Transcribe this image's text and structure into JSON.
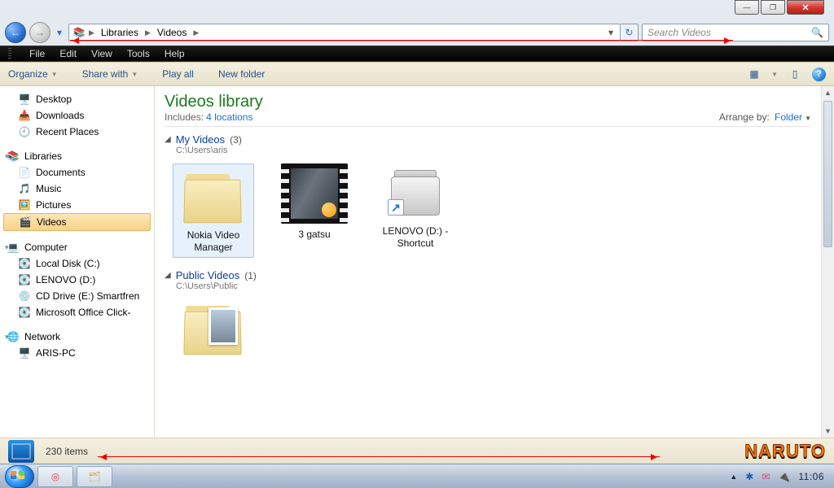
{
  "window_controls": {
    "min": "—",
    "max": "❐",
    "close": "✕"
  },
  "address": {
    "back_icon": "←",
    "fwd_icon": "→",
    "history_icon": "▾",
    "crumbs": [
      "Libraries",
      "Videos"
    ],
    "dropdown_icon": "▾",
    "refresh_icon": "↻"
  },
  "search": {
    "placeholder": "Search Videos",
    "icon": "🔍"
  },
  "menu": {
    "items": [
      "File",
      "Edit",
      "View",
      "Tools",
      "Help"
    ]
  },
  "toolbar": {
    "organize": "Organize",
    "share": "Share with",
    "playall": "Play all",
    "newfolder": "New folder",
    "dd": "▼",
    "view_icon": "▦",
    "pane_icon": "▯",
    "help": "?"
  },
  "nav": {
    "favorites": [
      {
        "icon": "🖥️",
        "label": "Desktop"
      },
      {
        "icon": "📥",
        "label": "Downloads"
      },
      {
        "icon": "🕘",
        "label": "Recent Places"
      }
    ],
    "libraries_label": "Libraries",
    "libraries_icon": "📚",
    "libraries": [
      {
        "icon": "📄",
        "label": "Documents"
      },
      {
        "icon": "🎵",
        "label": "Music"
      },
      {
        "icon": "🖼️",
        "label": "Pictures"
      },
      {
        "icon": "🎬",
        "label": "Videos",
        "selected": true
      }
    ],
    "computer_label": "Computer",
    "computer_icon": "💻",
    "drives": [
      {
        "icon": "💽",
        "label": "Local Disk (C:)"
      },
      {
        "icon": "💽",
        "label": "LENOVO (D:)"
      },
      {
        "icon": "💿",
        "label": "CD Drive (E:) Smartfren"
      },
      {
        "icon": "💽",
        "label": "Microsoft Office Click-"
      }
    ],
    "network_label": "Network",
    "network_icon": "🌐",
    "network": [
      {
        "icon": "🖥️",
        "label": "ARIS-PC"
      }
    ],
    "tri_open": "▾",
    "tri_closed": "▸"
  },
  "content": {
    "title": "Videos library",
    "includes_label": "Includes:",
    "includes_link": "4 locations",
    "arrange_label": "Arrange by:",
    "arrange_value": "Folder",
    "arrange_dd": "▼",
    "groups": [
      {
        "title": "My Videos",
        "count": "(3)",
        "path": "C:\\Users\\aris",
        "items": [
          {
            "kind": "folder",
            "label": "Nokia Video Manager",
            "selected": true
          },
          {
            "kind": "film",
            "label": "3 gatsu"
          },
          {
            "kind": "drive",
            "label": "LENOVO (D:) - Shortcut"
          }
        ]
      },
      {
        "title": "Public Videos",
        "count": "(1)",
        "path": "C:\\Users\\Public",
        "items": [
          {
            "kind": "folder-peek",
            "label": ""
          }
        ]
      }
    ],
    "scroll_up": "▲",
    "scroll_dn": "▼"
  },
  "details": {
    "count": "230 items",
    "naruto": "NARUTO"
  },
  "taskbar": {
    "pins": [
      {
        "name": "chrome",
        "glyph": "◎"
      },
      {
        "name": "explorer",
        "glyph": "🗂"
      }
    ],
    "tray": [
      {
        "name": "up",
        "glyph": "▲"
      },
      {
        "name": "bt",
        "glyph": "✱"
      },
      {
        "name": "mail",
        "glyph": "✉"
      },
      {
        "name": "power",
        "glyph": "🔌"
      }
    ],
    "clock": "11:06"
  }
}
